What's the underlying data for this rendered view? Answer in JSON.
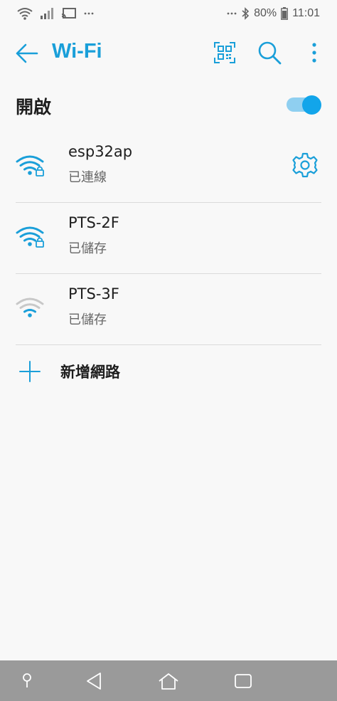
{
  "status_bar": {
    "battery": "80%",
    "time": "11:01",
    "icons": [
      "wifi-icon",
      "signal-icon",
      "cast-icon",
      "more-dots-icon",
      "bluetooth-icon",
      "battery-icon"
    ]
  },
  "app_bar": {
    "title": "Wi-Fi",
    "icons": [
      "back-arrow-icon",
      "qr-code-icon",
      "search-icon",
      "more-vert-icon"
    ]
  },
  "toggle": {
    "label": "開啟",
    "on": true
  },
  "networks": [
    {
      "ssid": "esp32ap",
      "state": "已連線",
      "secured": true,
      "signal": "strong",
      "has_settings": true
    },
    {
      "ssid": "PTS-2F",
      "state": "已儲存",
      "secured": true,
      "signal": "strong",
      "has_settings": false
    },
    {
      "ssid": "PTS-3F",
      "state": "已儲存",
      "secured": false,
      "signal": "weak",
      "has_settings": false
    }
  ],
  "add_network": {
    "label": "新增網路"
  },
  "nav_bar": {
    "icons": [
      "assistant-pin-icon",
      "back-triangle-icon",
      "home-icon",
      "recents-icon"
    ]
  },
  "colors": {
    "accent": "#1a9fd9",
    "switch_thumb": "#12a5ea",
    "switch_track": "#8fcff0",
    "wifi_weak": "#c8c8c8",
    "nav_bar": "#9a9a9a"
  }
}
